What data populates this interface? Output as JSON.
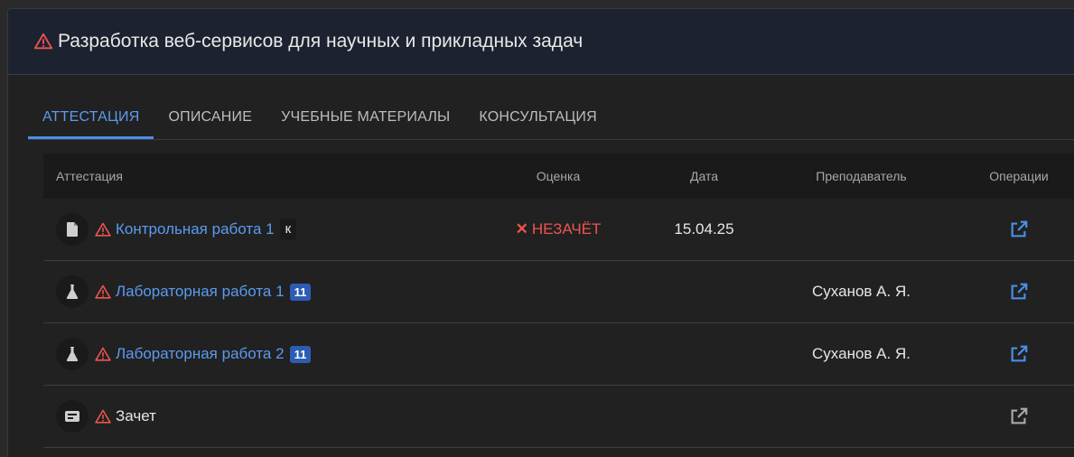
{
  "header": {
    "title": "Разработка веб-сервисов для научных и прикладных задач"
  },
  "tabs": [
    {
      "label": "АТТЕСТАЦИЯ",
      "active": true
    },
    {
      "label": "ОПИСАНИЕ"
    },
    {
      "label": "УЧЕБНЫЕ МАТЕРИАЛЫ"
    },
    {
      "label": "КОНСУЛЬТАЦИЯ"
    }
  ],
  "table": {
    "columns": [
      "Аттестация",
      "Оценка",
      "Дата",
      "Преподаватель",
      "Операции"
    ],
    "rows": [
      {
        "icon": "document-icon",
        "name": "Контрольная работа 1",
        "badge": "к",
        "grade": "НЕЗАЧЁТ",
        "grade_icon": "✕",
        "date": "15.04.25",
        "teacher": ""
      },
      {
        "icon": "flask-icon",
        "name": "Лабораторная работа 1",
        "badge": "11",
        "grade": "",
        "date": "",
        "teacher": "Суханов А. Я."
      },
      {
        "icon": "flask-icon",
        "name": "Лабораторная работа 2",
        "badge": "11",
        "grade": "",
        "date": "",
        "teacher": "Суханов А. Я."
      },
      {
        "icon": "credit-card-icon",
        "name": "Зачет",
        "badge": "",
        "grade": "",
        "date": "",
        "teacher": ""
      }
    ]
  },
  "colors": {
    "accent": "#5b9bf0",
    "warning": "#ef5350",
    "badge": "#2d5cb3"
  }
}
